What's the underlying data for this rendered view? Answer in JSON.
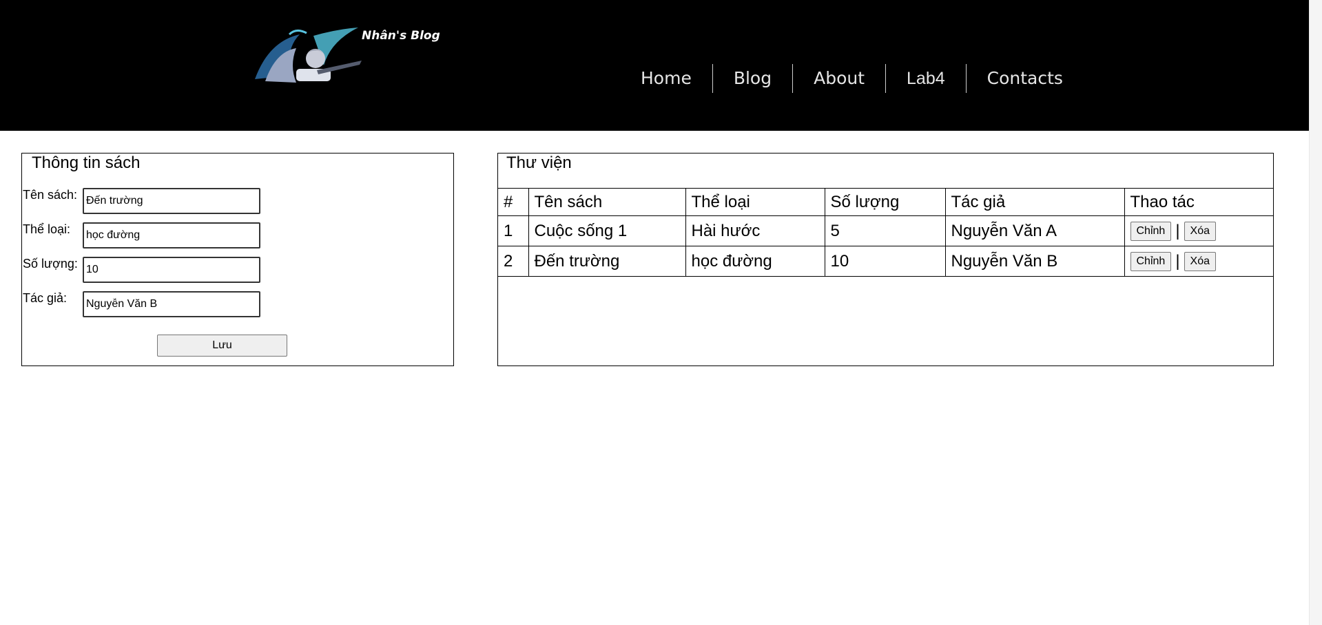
{
  "header": {
    "blog_title": "Nhân's Blog",
    "nav": [
      "Home",
      "Blog",
      "About",
      "Lab4",
      "Contacts"
    ]
  },
  "form": {
    "title": "Thông tin sách",
    "fields": [
      {
        "label": "Tên sách:",
        "value": "Đến trường"
      },
      {
        "label": "Thể loại:",
        "value": "học đường"
      },
      {
        "label": "Số lượng:",
        "value": "10"
      },
      {
        "label": "Tác giả:",
        "value": "Nguyễn Văn B"
      }
    ],
    "save_label": "Lưu"
  },
  "library": {
    "title": "Thư viện",
    "columns": [
      "#",
      "Tên sách",
      "Thể loại",
      "Số lượng",
      "Tác giả",
      "Thao tác"
    ],
    "rows": [
      {
        "no": "1",
        "name": "Cuộc sống 1",
        "genre": "Hài hước",
        "qty": "5",
        "author": "Nguyễn Văn A"
      },
      {
        "no": "2",
        "name": "Đến trường",
        "genre": "học đường",
        "qty": "10",
        "author": "Nguyễn Văn B"
      }
    ],
    "edit_label": "Chỉnh",
    "delete_label": "Xóa",
    "action_sep": "|"
  },
  "colors": {
    "header_bg": "#000000",
    "nav_text": "#e6e6e6"
  }
}
